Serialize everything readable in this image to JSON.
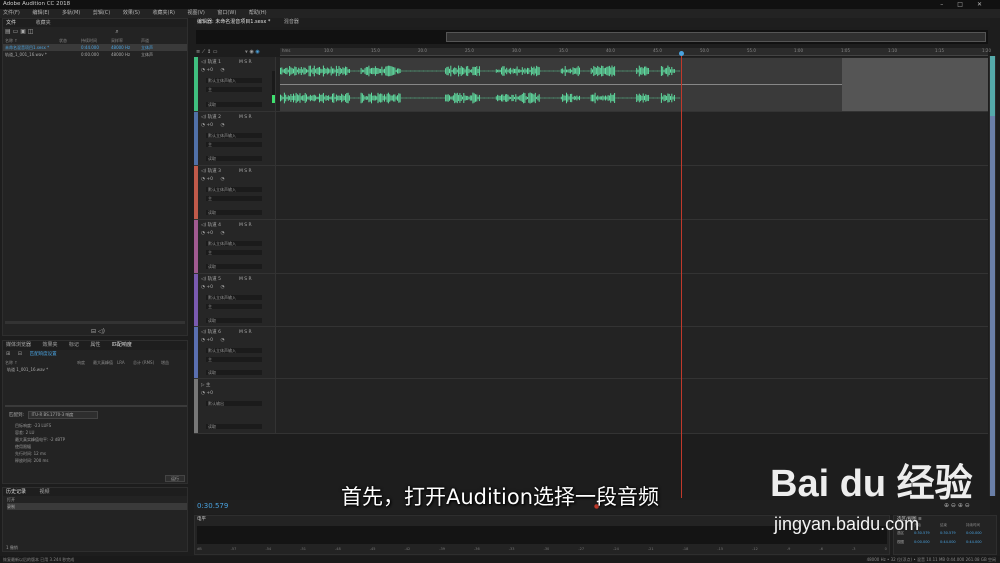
{
  "window": {
    "title": "Adobe Audition CC 2018"
  },
  "menu": [
    "文件(F)",
    "编辑(E)",
    "多轨(M)",
    "剪辑(C)",
    "效果(S)",
    "收藏夹(R)",
    "视图(V)",
    "窗口(W)",
    "帮助(H)"
  ],
  "files_panel": {
    "tabs": [
      "文件",
      "收藏夹"
    ],
    "columns": [
      "名称 ↑",
      "状态",
      "持续时间",
      "采样率",
      "声道"
    ],
    "rows": [
      {
        "name": "未命名混音项目1.sesx *",
        "duration": "0:44.000",
        "rate": "48000 Hz",
        "channels": "立体声"
      },
      {
        "name": "轨道_1_001_16.wav *",
        "duration": "0:00.000",
        "rate": "48000 Hz",
        "channels": "立体声"
      }
    ]
  },
  "editor_tabs": [
    "编辑器: 未命名混音项目1.sesx *",
    "混音器"
  ],
  "ruler_ticks": [
    "hms",
    "10.0",
    "15.0",
    "20.0",
    "25.0",
    "30.0",
    "35.0",
    "40.0",
    "45.0",
    "50.0",
    "55.0",
    "1:00",
    "1:05",
    "1:10",
    "1:15",
    "1:20",
    "1:25",
    "1:30"
  ],
  "tracks": [
    {
      "name": "轨道 1",
      "vol": "+0",
      "input": "默认立体声输入",
      "out": "主",
      "mode": "读取"
    },
    {
      "name": "轨道 2",
      "vol": "+0",
      "input": "默认立体声输入",
      "out": "主",
      "mode": "读取"
    },
    {
      "name": "轨道 3",
      "vol": "+0",
      "input": "默认立体声输入",
      "out": "主",
      "mode": "读取"
    },
    {
      "name": "轨道 4",
      "vol": "+0",
      "input": "默认立体声输入",
      "out": "主",
      "mode": "读取"
    },
    {
      "name": "轨道 5",
      "vol": "+0",
      "input": "默认立体声输入",
      "out": "主",
      "mode": "读取"
    },
    {
      "name": "轨道 6",
      "vol": "+0",
      "input": "默认立体声输入",
      "out": "主",
      "mode": "读取"
    },
    {
      "name": "主",
      "vol": "+0",
      "input": "默认输出",
      "out": "",
      "mode": "读取"
    }
  ],
  "lower_left": {
    "tabs": [
      "媒体浏览器",
      "效果夹",
      "标记",
      "属性",
      "匹配响度"
    ],
    "sub_button": "匹配响度设置",
    "columns": [
      "名称 ↑",
      "响度",
      "最大真峰值",
      "LRA",
      "总计 (RMS)",
      "增益"
    ],
    "item": "轨道 1_001_16.wav *",
    "match_to_label": "匹配到:",
    "match_to_value": "ITU-R BS.1770-3 响度",
    "fields": [
      "目标响度: -23 LUFS",
      "容差: 2 LU",
      "最大真实峰值电平: -2 dBTP",
      "使用限幅",
      "先行时间: 12 ms",
      "释放时间: 200 ms"
    ],
    "run_button": "运行"
  },
  "history": {
    "tabs": [
      "历史记录",
      "视频"
    ],
    "items": [
      "打开",
      "录制"
    ],
    "count": "1 撤销"
  },
  "transport": {
    "time": "0:30.579"
  },
  "levels": {
    "label": "电平",
    "scale": [
      "dB",
      "-57",
      "-54",
      "-51",
      "-48",
      "-45",
      "-42",
      "-39",
      "-36",
      "-33",
      "-30",
      "-27",
      "-24",
      "-21",
      "-18",
      "-15",
      "-12",
      "-9",
      "-6",
      "-3",
      "0"
    ]
  },
  "selection": {
    "title": "选区/视图 ≡",
    "columns": [
      "开始",
      "结束",
      "持续时间"
    ],
    "rows": [
      {
        "label": "选区",
        "start": "0:30.579",
        "end": "0:30.579",
        "dur": "0:00.000"
      },
      {
        "label": "视图",
        "start": "0:00.000",
        "end": "0:44.000",
        "dur": "0:44.000"
      }
    ]
  },
  "status": {
    "left": "恢复最新以后的版本 已用 3.244 秒完成",
    "right": "48000 Hz • 32 位(浮点) • 混音    10.11 MB    0:44.000    261.08 GB 空闲"
  },
  "overlay": {
    "subtitle": "首先，打开Audition选择一段音频",
    "watermark": "Bai du 经验",
    "url": "jingyan.baidu.com"
  },
  "colors": {
    "waveform": "#5fdca0",
    "playhead": "#c0392b",
    "track_colors": [
      "#3fbf7f",
      "#5070a8",
      "#c05a4a",
      "#a05a90",
      "#7a5ab0",
      "#5a6fb0",
      "#777"
    ]
  }
}
